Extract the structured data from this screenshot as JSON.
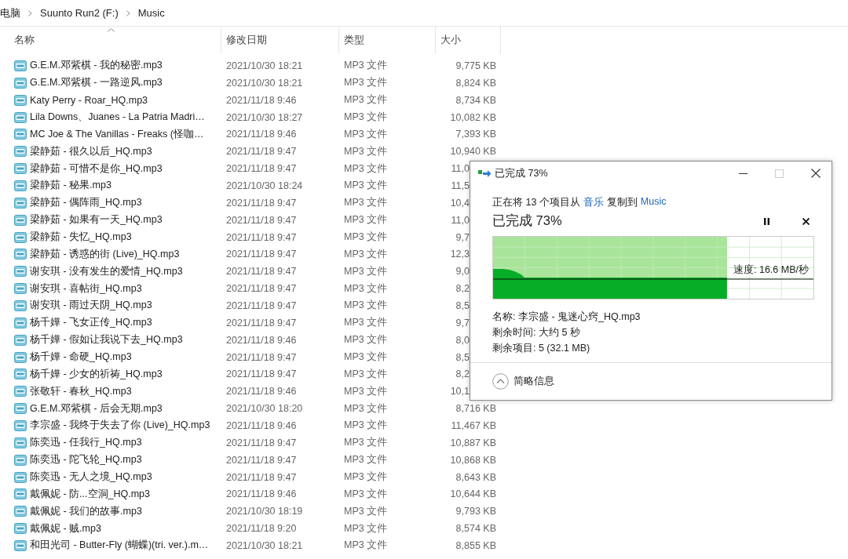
{
  "breadcrumb": [
    "电脑",
    "Suunto Run2 (F:)",
    "Music"
  ],
  "columns": [
    {
      "label": "名称",
      "sorted": true
    },
    {
      "label": "修改日期",
      "sorted": false
    },
    {
      "label": "类型",
      "sorted": false
    },
    {
      "label": "大小",
      "sorted": false
    }
  ],
  "files": [
    {
      "name": "G.E.M.邓紫棋 - 我的秘密.mp3",
      "modified": "2021/10/30 18:21",
      "type": "MP3 文件",
      "size": "9,775 KB",
      "cut": false
    },
    {
      "name": "G.E.M.邓紫棋 - 一路逆风.mp3",
      "modified": "2021/10/30 18:21",
      "type": "MP3 文件",
      "size": "8,824 KB",
      "cut": false
    },
    {
      "name": "Katy Perry - Roar_HQ.mp3",
      "modified": "2021/11/18 9:46",
      "type": "MP3 文件",
      "size": "8,734 KB",
      "cut": false
    },
    {
      "name": "Lila Downs、Juanes - La Patria Madri…",
      "modified": "2021/10/30 18:27",
      "type": "MP3 文件",
      "size": "10,082 KB",
      "cut": false
    },
    {
      "name": "MC Joe & The Vanillas - Freaks (怪咖…",
      "modified": "2021/11/18 9:46",
      "type": "MP3 文件",
      "size": "7,393 KB",
      "cut": false
    },
    {
      "name": "梁静茹 - 很久以后_HQ.mp3",
      "modified": "2021/11/18 9:47",
      "type": "MP3 文件",
      "size": "10,940 KB",
      "cut": false
    },
    {
      "name": "梁静茹 - 可惜不是你_HQ.mp3",
      "modified": "2021/11/18 9:47",
      "type": "MP3 文件",
      "size": "11,0",
      "cut": true
    },
    {
      "name": "梁静茹 - 秘果.mp3",
      "modified": "2021/10/30 18:24",
      "type": "MP3 文件",
      "size": "11,5",
      "cut": true
    },
    {
      "name": "梁静茹 - 偶阵雨_HQ.mp3",
      "modified": "2021/11/18 9:47",
      "type": "MP3 文件",
      "size": "10,4",
      "cut": true
    },
    {
      "name": "梁静茹 - 如果有一天_HQ.mp3",
      "modified": "2021/11/18 9:47",
      "type": "MP3 文件",
      "size": "11,0",
      "cut": true
    },
    {
      "name": "梁静茹 - 失忆_HQ.mp3",
      "modified": "2021/11/18 9:47",
      "type": "MP3 文件",
      "size": "9,7",
      "cut": true
    },
    {
      "name": "梁静茹 - 诱惑的街 (Live)_HQ.mp3",
      "modified": "2021/11/18 9:47",
      "type": "MP3 文件",
      "size": "12,3",
      "cut": true
    },
    {
      "name": "谢安琪 - 没有发生的爱情_HQ.mp3",
      "modified": "2021/11/18 9:47",
      "type": "MP3 文件",
      "size": "9,0",
      "cut": true
    },
    {
      "name": "谢安琪 - 喜帖街_HQ.mp3",
      "modified": "2021/11/18 9:47",
      "type": "MP3 文件",
      "size": "8,2",
      "cut": true
    },
    {
      "name": "谢安琪 - 雨过天阴_HQ.mp3",
      "modified": "2021/11/18 9:47",
      "type": "MP3 文件",
      "size": "8,5",
      "cut": true
    },
    {
      "name": "杨千嬅 - 飞女正传_HQ.mp3",
      "modified": "2021/11/18 9:47",
      "type": "MP3 文件",
      "size": "9,7",
      "cut": true
    },
    {
      "name": "杨千嬅 - 假如让我说下去_HQ.mp3",
      "modified": "2021/11/18 9:46",
      "type": "MP3 文件",
      "size": "8,0",
      "cut": true
    },
    {
      "name": "杨千嬅 - 命硬_HQ.mp3",
      "modified": "2021/11/18 9:47",
      "type": "MP3 文件",
      "size": "8,5",
      "cut": true
    },
    {
      "name": "杨千嬅 - 少女的祈祷_HQ.mp3",
      "modified": "2021/11/18 9:47",
      "type": "MP3 文件",
      "size": "8,2",
      "cut": true
    },
    {
      "name": "张敬轩 - 春秋_HQ.mp3",
      "modified": "2021/11/18 9:46",
      "type": "MP3 文件",
      "size": "10,1",
      "cut": true
    },
    {
      "name": "G.E.M.邓紫棋 - 后会无期.mp3",
      "modified": "2021/10/30 18:20",
      "type": "MP3 文件",
      "size": "8,716 KB",
      "cut": false
    },
    {
      "name": "李宗盛 - 我终于失去了你 (Live)_HQ.mp3",
      "modified": "2021/11/18 9:46",
      "type": "MP3 文件",
      "size": "11,467 KB",
      "cut": false
    },
    {
      "name": "陈奕迅 - 任我行_HQ.mp3",
      "modified": "2021/11/18 9:47",
      "type": "MP3 文件",
      "size": "10,887 KB",
      "cut": false
    },
    {
      "name": "陈奕迅 - 陀飞轮_HQ.mp3",
      "modified": "2021/11/18 9:47",
      "type": "MP3 文件",
      "size": "10,868 KB",
      "cut": false
    },
    {
      "name": "陈奕迅 - 无人之境_HQ.mp3",
      "modified": "2021/11/18 9:47",
      "type": "MP3 文件",
      "size": "8,643 KB",
      "cut": false
    },
    {
      "name": "戴佩妮 - 防...空洞_HQ.mp3",
      "modified": "2021/11/18 9:46",
      "type": "MP3 文件",
      "size": "10,644 KB",
      "cut": false
    },
    {
      "name": "戴佩妮 - 我们的故事.mp3",
      "modified": "2021/10/30 18:19",
      "type": "MP3 文件",
      "size": "9,793 KB",
      "cut": false
    },
    {
      "name": "戴佩妮 - 贼.mp3",
      "modified": "2021/11/18 9:20",
      "type": "MP3 文件",
      "size": "8,574 KB",
      "cut": false
    },
    {
      "name": "和田光司 - Butter-Fly (蝴蝶)(tri. ver.).m…",
      "modified": "2021/10/30 18:21",
      "type": "MP3 文件",
      "size": "8,855 KB",
      "cut": false
    }
  ],
  "dialog": {
    "title": "已完成 73%",
    "copy_parts": [
      {
        "text": "正在将 13 个项目从",
        "kind": "plain"
      },
      {
        "text": "音乐",
        "kind": "link"
      },
      {
        "text": "复制到",
        "kind": "plain"
      },
      {
        "text": "Music",
        "kind": "link"
      }
    ],
    "heading": "已完成 73%",
    "level": 0.73,
    "speed": "速度: 16.6 MB/秒",
    "details": [
      "名称: 李宗盛 - 鬼迷心窍_HQ.mp3",
      "剩余时间: 大约 5 秒",
      "剩余项目: 5 (32.1 MB)"
    ],
    "maximize_disabled": true,
    "footer": "简略信息"
  }
}
